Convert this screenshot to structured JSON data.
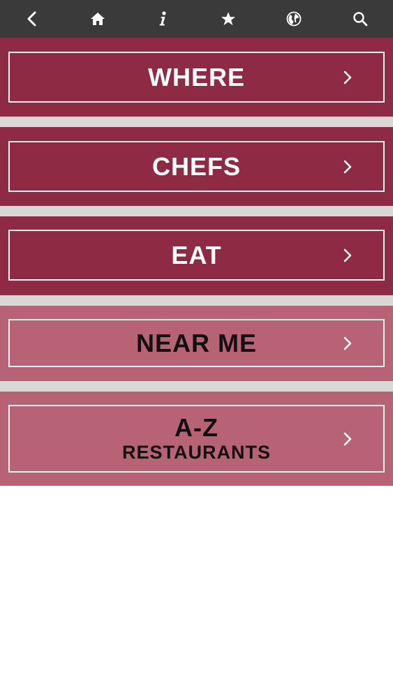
{
  "toolbar": {
    "icons": [
      "back-chevron-icon",
      "home-icon",
      "info-icon",
      "star-icon",
      "globe-icon",
      "search-icon"
    ],
    "background": "#3a3a3a"
  },
  "menu": {
    "items": [
      {
        "label": "WHERE"
      },
      {
        "label": "CHEFS"
      },
      {
        "label": "EAT"
      },
      {
        "label": "NEAR ME"
      },
      {
        "label_line1": "A-Z",
        "label_line2": "RESTAURANTS"
      }
    ]
  },
  "colors": {
    "tile_dark": "#8e2a43",
    "tile_light": "#b86275",
    "separator": "#d8d8d6",
    "frame": "#f2f2f2"
  }
}
